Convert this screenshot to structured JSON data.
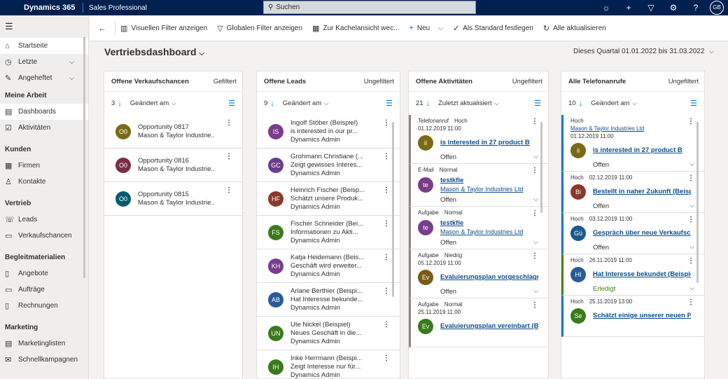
{
  "topbar": {
    "brand": "Dynamics 365",
    "app": "Sales Professional",
    "search_placeholder": "Suchen",
    "user_initials": "GB"
  },
  "sidebar": {
    "items_top": [
      {
        "label": "Startseite",
        "icon": "home-icon",
        "active": true
      },
      {
        "label": "Letzte",
        "icon": "clock-icon",
        "chevron": true
      },
      {
        "label": "Angeheftet",
        "icon": "pin-icon",
        "chevron": true
      }
    ],
    "groups": [
      {
        "title": "Meine Arbeit",
        "items": [
          {
            "label": "Dashboards",
            "icon": "dashboard-icon",
            "active": true
          },
          {
            "label": "Aktivitäten",
            "icon": "activities-icon"
          }
        ]
      },
      {
        "title": "Kunden",
        "items": [
          {
            "label": "Firmen",
            "icon": "building-icon"
          },
          {
            "label": "Kontakte",
            "icon": "person-icon"
          }
        ]
      },
      {
        "title": "Vertrieb",
        "items": [
          {
            "label": "Leads",
            "icon": "phone-icon"
          },
          {
            "label": "Verkaufschancen",
            "icon": "document-icon"
          }
        ]
      },
      {
        "title": "Begleitmaterialien",
        "items": [
          {
            "label": "Angebote",
            "icon": "quote-icon"
          },
          {
            "label": "Aufträge",
            "icon": "order-icon"
          },
          {
            "label": "Rechnungen",
            "icon": "invoice-icon"
          }
        ]
      },
      {
        "title": "Marketing",
        "items": [
          {
            "label": "Marketinglisten",
            "icon": "list-icon"
          },
          {
            "label": "Schnellkampagnen",
            "icon": "campaign-icon"
          }
        ]
      }
    ]
  },
  "toolbar": {
    "visual_filter": "Visuellen Filter anzeigen",
    "global_filter": "Globalen Filter anzeigen",
    "tile_view": "Zur Kachelansicht wec...",
    "new": "Neu",
    "set_default": "Als Standard festlegen",
    "refresh_all": "Alle aktualisieren"
  },
  "dashboard": {
    "title": "Vertriebsdashboard",
    "period": "Dieses Quartal 01.01.2022 bis 31.03.2022"
  },
  "panels": {
    "opportunities": {
      "title": "Offene Verkaufschancen",
      "filter": "Gefiltert",
      "count": "3",
      "sort": "Geändert am",
      "items": [
        {
          "initials": "O0",
          "color": "#7a6a15",
          "l1": "Opportunity 0817",
          "l2": "Mason & Taylor Industrie..."
        },
        {
          "initials": "O0",
          "color": "#7a2d47",
          "l1": "Opportunity 0816",
          "l2": "Mason & Taylor Industrie..."
        },
        {
          "initials": "O0",
          "color": "#005b70",
          "l1": "Opportunity 0815",
          "l2": "Mason & Taylor Industrie..."
        }
      ]
    },
    "leads": {
      "title": "Offene Leads",
      "filter": "Ungefiltert",
      "count": "9",
      "sort": "Geändert am",
      "items": [
        {
          "initials": "IS",
          "color": "#7a3d8a",
          "l1": "Ingolf Stöber (Beispiel)",
          "l2": "is interested in our pr...",
          "l3": "Dynamics Admin"
        },
        {
          "initials": "GC",
          "color": "#6b3d8a",
          "l1": "Grohmann Christiane (...",
          "l2": "Zeigt gewisses Interes...",
          "l3": "Dynamics Admin"
        },
        {
          "initials": "HF",
          "color": "#8a3a2a",
          "l1": "Heinrich Fischer (Beisp...",
          "l2": "Schätzt unsere Produk...",
          "l3": "Dynamics Admin"
        },
        {
          "initials": "FS",
          "color": "#3a7a1a",
          "l1": "Fischer Schneider (Bei...",
          "l2": "Informationen zu Akti...",
          "l3": "Dynamics Admin"
        },
        {
          "initials": "KH",
          "color": "#7a3d8a",
          "l1": "Katja Heidemann (Beis...",
          "l2": "Geschäft wird erweiter...",
          "l3": "Dynamics Admin"
        },
        {
          "initials": "AB",
          "color": "#2a5a9a",
          "l1": "Ariane Berthier (Beispi...",
          "l2": "Hat Interesse bekunde...",
          "l3": "Dynamics Admin"
        },
        {
          "initials": "UN",
          "color": "#3a7a1a",
          "l1": "Ute Nickel (Beispiel)",
          "l2": "Neues Geschäft in die...",
          "l3": "Dynamics Admin"
        },
        {
          "initials": "IH",
          "color": "#3a7a1a",
          "l1": "Inke Herrmann (Beispi...",
          "l2": "Zeigt Interesse nur für...",
          "l3": "Dynamics Admin"
        }
      ]
    },
    "activities": {
      "title": "Offene Aktivitäten",
      "filter": "Ungefiltert",
      "count": "21",
      "sort": "Zuletzt aktualisiert",
      "items": [
        {
          "type": "Telefonanruf",
          "prio": "Hoch",
          "date": "01.12.2019 11:00",
          "initials": "ii",
          "color": "#7a6a15",
          "subject": "is interested in 27 product B",
          "regarding": "",
          "status": "Offen"
        },
        {
          "type": "E-Mail",
          "prio": "Normal",
          "date": "",
          "initials": "te",
          "color": "#7a3d8a",
          "subject": "testkfie",
          "regarding": "Mason & Taylor Industries Ltd",
          "status": "Offen"
        },
        {
          "type": "Aufgabe",
          "prio": "Normal",
          "date": "",
          "initials": "te",
          "color": "#7a3d8a",
          "subject": "testkfie",
          "regarding": "Mason & Taylor Industries Ltd",
          "status": "Offen"
        },
        {
          "type": "Aufgabe",
          "prio": "Niedrig",
          "date": "05.12.2019 11:00",
          "initials": "Ev",
          "color": "#7a5a15",
          "subject": "Evaluierungsplan vorgeschlagen",
          "regarding": "",
          "status": "Offen"
        },
        {
          "type": "Aufgabe",
          "prio": "Normal",
          "date": "25.11.2019 11:00",
          "initials": "Ev",
          "color": "#3a7a1a",
          "subject": "Evaluierungsplan vereinbart (Be",
          "regarding": "",
          "status": ""
        }
      ]
    },
    "calls": {
      "title": "Alle Telefonanrufe",
      "filter": "Ungefiltert",
      "count": "10",
      "sort": "Geändert am",
      "items": [
        {
          "prio": "Hoch",
          "regarding": "Mason & Taylor Industries Ltd",
          "date": "01.12.2019 11:00",
          "initials": "ii",
          "color": "#7a6a15",
          "subject": "is interested in 27 product B",
          "status": "Offen"
        },
        {
          "prio": "Hoch",
          "regarding": "",
          "date": "02.12.2019 11:00",
          "initials": "Bi",
          "color": "#8a3a2a",
          "subject": "Bestellt in naher Zukunft (Beispi",
          "status": "Offen"
        },
        {
          "prio": "Hoch",
          "regarding": "",
          "date": "03.12.2019 11:00",
          "initials": "Gü",
          "color": "#1a5a8a",
          "subject": "Gespräch über neue Verkaufschä",
          "status": "Offen"
        },
        {
          "prio": "Hoch",
          "regarding": "",
          "date": "26.11.2019 11:00",
          "initials": "HI",
          "color": "#2a5a9a",
          "subject": "Hat Interesse bekundet (Beispie",
          "status": "Erledigt"
        },
        {
          "prio": "Hoch",
          "regarding": "",
          "date": "25.11.2019 13:00",
          "initials": "Se",
          "color": "#3a7a1a",
          "subject": "Schätzt einige unserer neuen Pr",
          "status": ""
        }
      ]
    }
  }
}
